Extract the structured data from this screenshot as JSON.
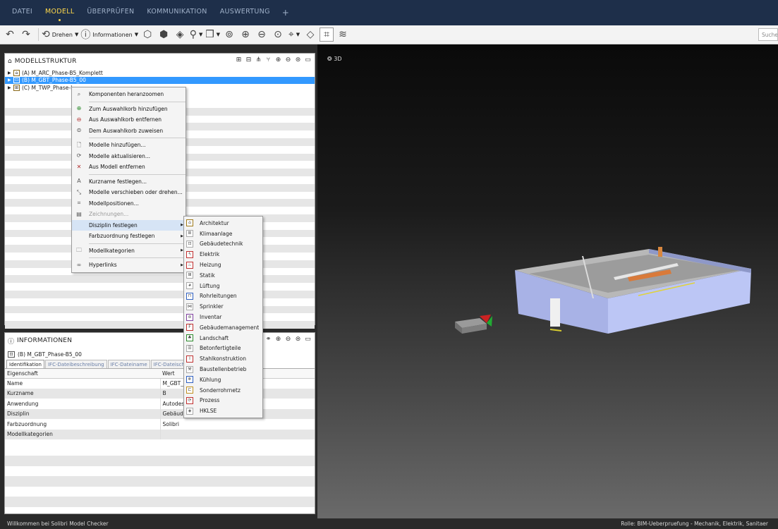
{
  "menubar": {
    "items": [
      "DATEI",
      "MODELL",
      "ÜBERPRÜFEN",
      "KOMMUNIKATION",
      "AUSWERTUNG"
    ],
    "plus": "+"
  },
  "toolbar": {
    "rotate_label": "Drehen",
    "info_label": "Informationen",
    "search_placeholder": "Suche"
  },
  "structure": {
    "title": "MODELLSTRUKTUR",
    "models": [
      {
        "label": "(A) M_ARC_Phase-B5_Komplett"
      },
      {
        "label": "(B) M_GBT_Phase-B5_00"
      },
      {
        "label": "(C) M_TWP_Phase-I"
      }
    ]
  },
  "context_menu": {
    "items": [
      "Komponenten heranzoomen",
      "Zum Auswahlkorb hinzufügen",
      "Aus Auswahlkorb entfernen",
      "Dem Auswahlkorb zuweisen",
      "Modelle hinzufügen...",
      "Modelle aktualisieren...",
      "Aus Modell entfernen",
      "Kurzname festlegen...",
      "Modelle verschieben oder drehen...",
      "Modellpositionen...",
      "Zeichnungen...",
      "Disziplin festlegen",
      "Farbzuordnung festlegen",
      "Modellkategorien",
      "Hyperlinks"
    ]
  },
  "submenu": {
    "items": [
      "Architektur",
      "Klimaanlage",
      "Gebäudetechnik",
      "Elektrik",
      "Heizung",
      "Statik",
      "Lüftung",
      "Rohrleitungen",
      "Sprinkler",
      "Inventar",
      "Gebäudemanagement",
      "Landschaft",
      "Betonfertigteile",
      "Stahlkonstruktion",
      "Baustellenbetrieb",
      "Kühlung",
      "Sonderrohrnetz",
      "Prozess",
      "HKLSE"
    ]
  },
  "info": {
    "title": "INFORMATIONEN",
    "object": "(B) M_GBT_Phase-B5_00",
    "tabs": [
      "Identifikation",
      "IFC-Dateibeschreibung",
      "IFC-Dateiname",
      "IFC-Dateisch"
    ],
    "col_property": "Eigenschaft",
    "col_value": "Wert",
    "rows": [
      {
        "k": "Name",
        "v": "M_GBT_P"
      },
      {
        "k": "Kurzname",
        "v": "B"
      },
      {
        "k": "Anwendung",
        "v": "Autodesk Revit 2017 (DEU)"
      },
      {
        "k": "Disziplin",
        "v": "Gebäudetechnik"
      },
      {
        "k": "Farbzuordnung",
        "v": "Solibri"
      },
      {
        "k": "Modellkategorien",
        "v": ""
      }
    ]
  },
  "viewport": {
    "label": "3D"
  },
  "status": {
    "left": "Willkommen bei Solibri Model Checker",
    "right": "Rolle: BIM-Ueberpruefung - Mechanik, Elektrik, Sanitaer"
  }
}
